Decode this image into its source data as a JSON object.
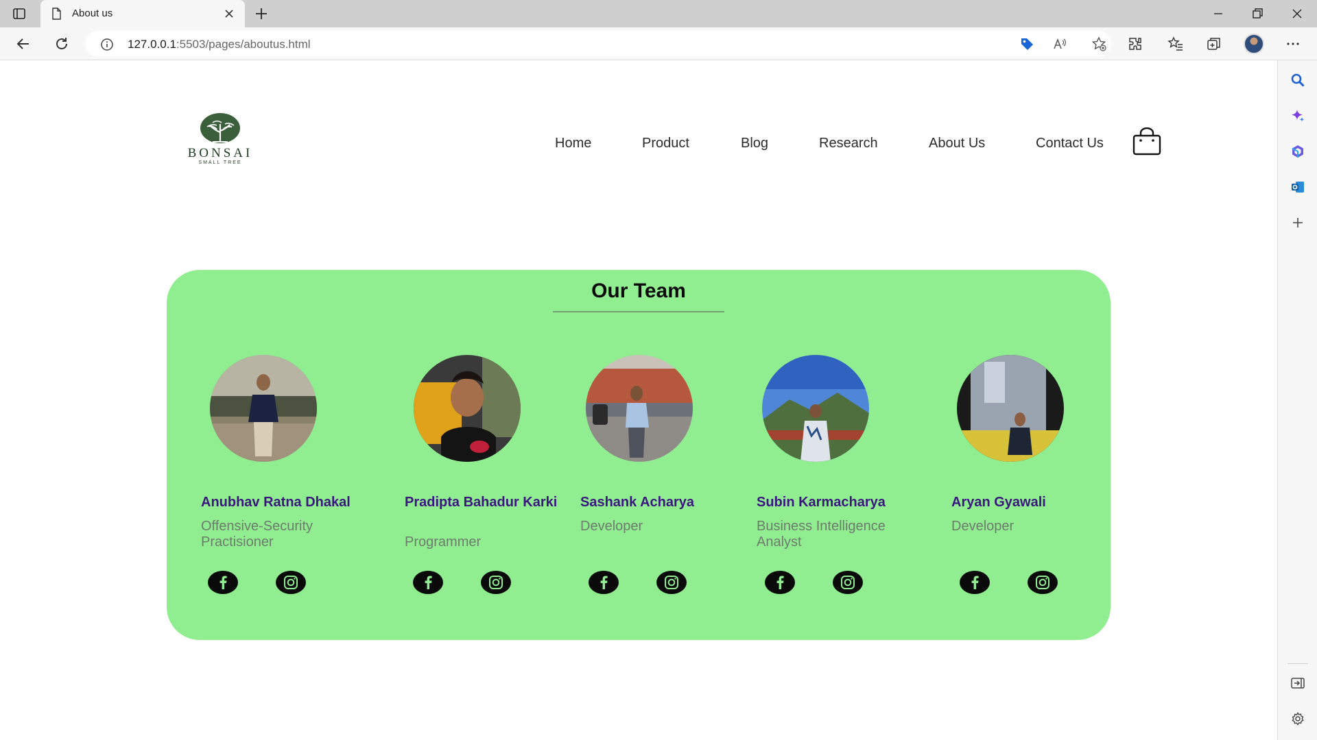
{
  "browser": {
    "tab_title": "About us",
    "url_host": "127.0.0.1",
    "url_rest": ":5503/pages/aboutus.html"
  },
  "logo": {
    "word": "BONSAI",
    "tagline": "SMALL TREE"
  },
  "nav": {
    "items": [
      "Home",
      "Product",
      "Blog",
      "Research",
      "About Us",
      "Contact Us"
    ]
  },
  "team": {
    "title": "Our Team",
    "members": [
      {
        "name": "Anubhav Ratna Dhakal",
        "role": "Offensive-Security Practisioner"
      },
      {
        "name": "Pradipta Bahadur Karki",
        "role": "Programmer"
      },
      {
        "name": "Sashank Acharya",
        "role": "Developer"
      },
      {
        "name": "Subin Karmacharya",
        "role": "Business Intelligence Analyst"
      },
      {
        "name": "Aryan Gyawali",
        "role": "Developer"
      }
    ]
  },
  "colors": {
    "card": "#90ee90",
    "name": "#3b167f",
    "role": "#6d7b6d"
  }
}
